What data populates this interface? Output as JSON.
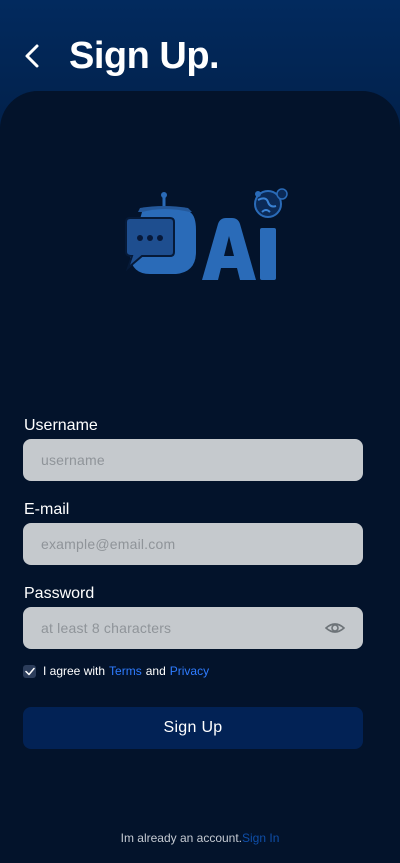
{
  "header": {
    "title": "Sign Up.",
    "back_icon": "chevron-left-icon"
  },
  "logo": {
    "text": "AI",
    "icon": "robot-chat-logo-icon",
    "color": "#2a6bb8"
  },
  "form": {
    "username": {
      "label": "Username",
      "placeholder": "username",
      "value": ""
    },
    "email": {
      "label": "E-mail",
      "placeholder": "example@email.com",
      "value": ""
    },
    "password": {
      "label": "Password",
      "placeholder": "at least 8 characters",
      "value": "",
      "toggle_icon": "eye-icon"
    },
    "agree": {
      "checked": true,
      "prefix": "I agree with",
      "terms_label": "Terms",
      "and_text": "and",
      "privacy_label": "Privacy"
    },
    "submit_label": "Sign Up"
  },
  "footer": {
    "text": "Im already an account.",
    "signin_label": "Sign In"
  },
  "colors": {
    "header_bg": "#02214b",
    "card_bg": "#03132b",
    "field_bg": "#c5c9cd",
    "button_bg": "#022255",
    "link": "#2f7cff"
  }
}
